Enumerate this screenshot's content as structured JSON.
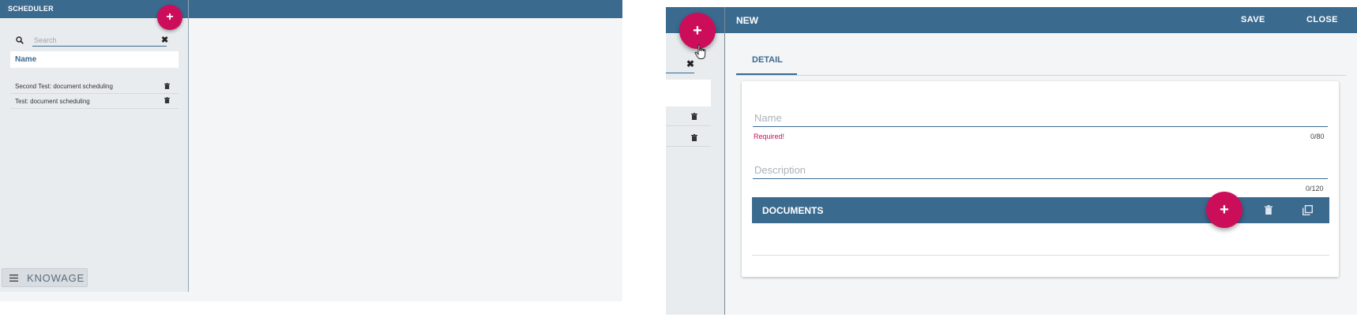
{
  "left_panel": {
    "title": "SCHEDULER",
    "add_label": "+",
    "search": {
      "placeholder": "Search",
      "value": "",
      "clear_icon": "close-icon"
    },
    "list_header": "Name",
    "items": [
      {
        "label": "Second Test: document scheduling",
        "icon": "trash-icon"
      },
      {
        "label": "Test: document scheduling",
        "icon": "trash-icon"
      }
    ],
    "footer": {
      "menu_icon": "hamburger-menu-icon",
      "brand": "KNOWAGE"
    }
  },
  "right_panel": {
    "title": "NEW",
    "save_label": "SAVE",
    "close_label": "CLOSE",
    "add_label": "+",
    "side_clear_glyph": "✖",
    "tabs": [
      {
        "label": "DETAIL",
        "active": true
      }
    ],
    "form": {
      "name": {
        "placeholder": "Name",
        "value": "",
        "error": "Required!",
        "counter": "0/80"
      },
      "description": {
        "placeholder": "Description",
        "value": "",
        "counter": "0/120"
      }
    },
    "documents": {
      "title": "DOCUMENTS",
      "add_label": "+",
      "actions": [
        "trash-icon",
        "copy-icon"
      ]
    }
  },
  "colors": {
    "header": "#3b6a8f",
    "accent": "#cc0e5a",
    "sidebar": "#e9ecef",
    "background": "#f4f5f6"
  }
}
